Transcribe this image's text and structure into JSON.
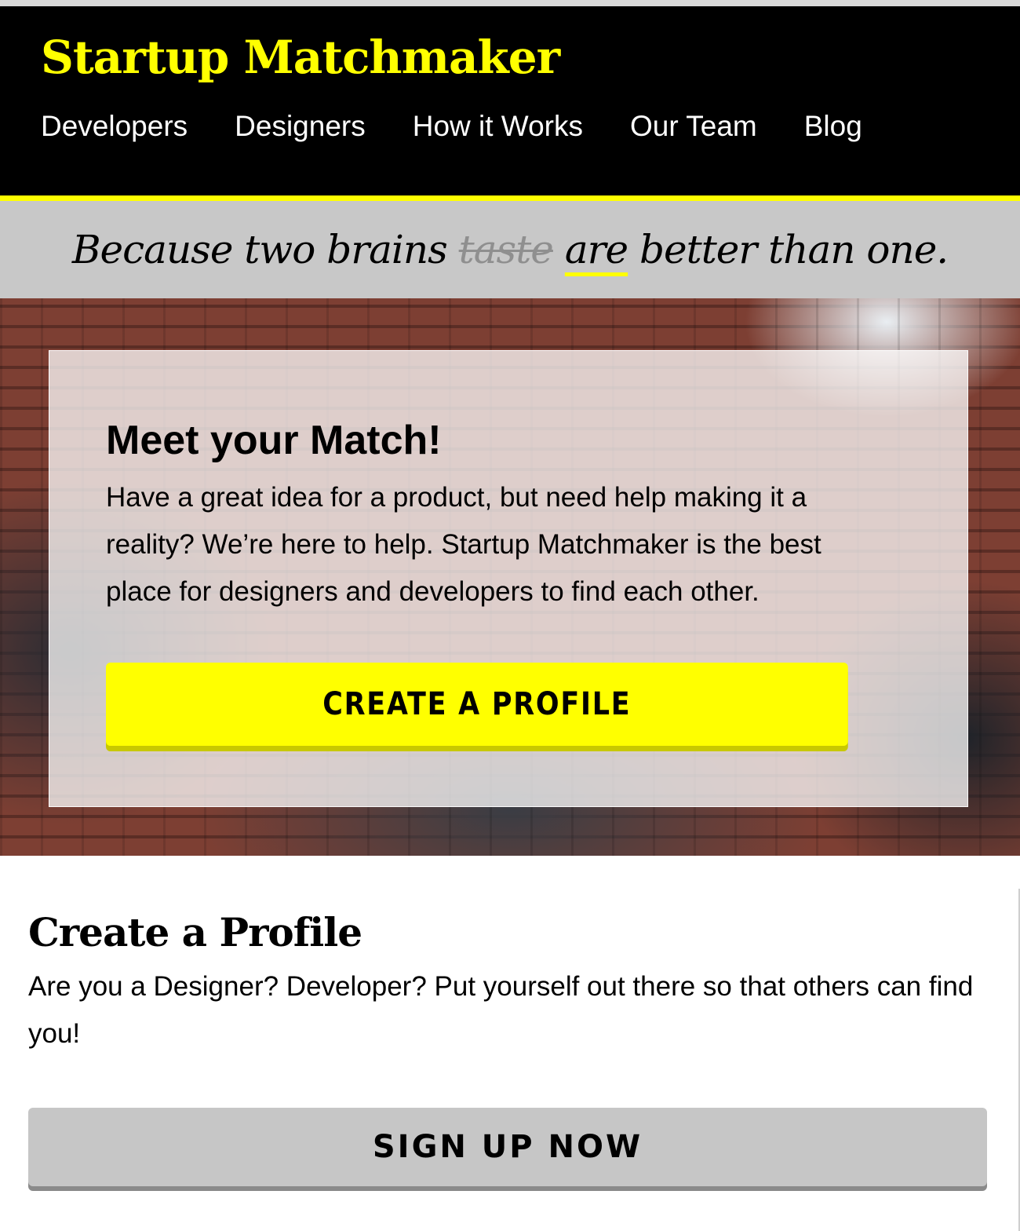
{
  "header": {
    "brand": "Startup Matchmaker",
    "nav": [
      "Developers",
      "Designers",
      "How it Works",
      "Our Team",
      "Blog"
    ]
  },
  "tagline": {
    "before": "Because two brains ",
    "struck": "taste",
    "underlined": "are",
    "after": " better than one."
  },
  "hero": {
    "title": "Meet your Match!",
    "text": "Have a great idea for a product, but need help making it a reality? We’re here to help. Startup Matchmaker is the best place for designers and developers to find each other.",
    "cta": "CREATE A PROFILE"
  },
  "profile_section": {
    "title": "Create a Profile",
    "text": "Are you a Designer? Developer? Put yourself out there so that others can find you!",
    "cta": "SIGN UP NOW"
  },
  "colors": {
    "accent": "#ffff00",
    "header_bg": "#000000",
    "tagline_bg": "#c8c8c8",
    "secondary_button": "#c6c6c6"
  }
}
